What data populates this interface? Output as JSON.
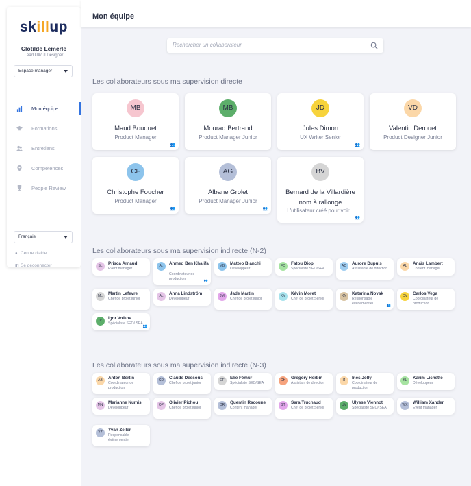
{
  "logo": {
    "prefix": "sk",
    "mid": "ill",
    "suffix": "up"
  },
  "user": {
    "name": "Clotilde Lemerle",
    "role": "Lead UX/UI Designer"
  },
  "space_select": {
    "value": "Espace manager"
  },
  "nav": [
    {
      "label": "Mon équipe",
      "icon": "bar-chart-icon",
      "active": true
    },
    {
      "label": "Formations",
      "icon": "graduation-cap-icon",
      "active": false
    },
    {
      "label": "Entretiens",
      "icon": "users-icon",
      "active": false
    },
    {
      "label": "Compétences",
      "icon": "location-pin-icon",
      "active": false
    },
    {
      "label": "People Review",
      "icon": "trophy-icon",
      "active": false
    }
  ],
  "language": {
    "value": "Français"
  },
  "footer": {
    "help": "Centre d'aide",
    "logout": "Se déconnecter"
  },
  "page": {
    "title": "Mon équipe"
  },
  "search": {
    "placeholder": "Rechercher un collaborateur"
  },
  "sections": {
    "direct": "Les collaborateurs sous ma supervision directe",
    "n2": "Les collaborateurs sous ma supervision indirecte (N-2)",
    "n3": "Les collaborateurs sous ma supervision indirecte (N-3)"
  },
  "direct_reports": [
    {
      "initials": "MB",
      "name": "Maud Bouquet",
      "role": "Product Manager",
      "color": "#f6c6cf",
      "team": true
    },
    {
      "initials": "MB",
      "name": "Mourad Bertrand",
      "role": "Product Manager Junior",
      "color": "#5cae6a",
      "team": false
    },
    {
      "initials": "JD",
      "name": "Jules Dimon",
      "role": "UX Writer Senior",
      "color": "#f7d33c",
      "team": true
    },
    {
      "initials": "VD",
      "name": "Valentin Derouet",
      "role": "Product Designer Junior",
      "color": "#fbd7a8",
      "team": false
    },
    {
      "initials": "CF",
      "name": "Christophe Foucher",
      "role": "Product Manager",
      "color": "#8dc4ec",
      "team": true
    },
    {
      "initials": "AG",
      "name": "Albane Grolet",
      "role": "Product Manager Junior",
      "color": "#b4bfd8",
      "team": true
    },
    {
      "initials": "BV",
      "name": "Bernard de la Villardière nom à rallonge",
      "role": "L'utilisateur créé pour voir...",
      "color": "#d5d5d5",
      "team": true
    }
  ],
  "n2_reports": [
    {
      "initials": "SL",
      "name": "Prisca Arnaud",
      "role": "Event manager",
      "color": "#e4c4e6",
      "team": false
    },
    {
      "initials": "A..",
      "name": "Ahmed Ben Khalifa",
      "role": "Coordinateur de production",
      "color": "#8dc4ec",
      "team": true
    },
    {
      "initials": "MB",
      "name": "Matteo Bianchi",
      "role": "Développeur",
      "color": "#8dc4ec",
      "team": false
    },
    {
      "initials": "FD",
      "name": "Fatou Diop",
      "role": "Spécialiste SEO/SEA",
      "color": "#a6e3a1",
      "team": false
    },
    {
      "initials": "AD",
      "name": "Aurore Dupuis",
      "role": "Assistante de direction",
      "color": "#9fcdf0",
      "team": false
    },
    {
      "initials": "AL",
      "name": "Anaïs Lambert",
      "role": "Content manager",
      "color": "#fbd7a8",
      "team": false
    },
    {
      "initials": "ML",
      "name": "Martin Lefevre",
      "role": "Chef de projet junior",
      "color": "#d5d5d5",
      "team": false
    },
    {
      "initials": "AL",
      "name": "Anna Lindström",
      "role": "Développeur",
      "color": "#e4c4e6",
      "team": false
    },
    {
      "initials": "JM",
      "name": "Jade Martin",
      "role": "Chef de projet junior",
      "color": "#e2a6ea",
      "team": false
    },
    {
      "initials": "KM",
      "name": "Kévin Moret",
      "role": "Chef de projet Senior",
      "color": "#a7e2ec",
      "team": false
    },
    {
      "initials": "KN",
      "name": "Katarina Novak",
      "role": "Responsable évènementiel",
      "color": "#d8c3a2",
      "team": true
    },
    {
      "initials": "CV",
      "name": "Carlos Vega",
      "role": "Coordinateur de production",
      "color": "#f7d33c",
      "team": false
    },
    {
      "initials": "IV",
      "name": "Igor Volkov",
      "role": "Spécialiste SEO/ SEA",
      "color": "#5cae6a",
      "team": true
    }
  ],
  "n3_reports": [
    {
      "initials": "AB",
      "name": "Anton Bertin",
      "role": "Coordinateur de production",
      "color": "#fbd7a8",
      "team": false
    },
    {
      "initials": "CD",
      "name": "Claude Dessous",
      "role": "Chef de projet junior",
      "color": "#b4bfd8",
      "team": false
    },
    {
      "initials": "EF",
      "name": "Elie Fémur",
      "role": "Spécialiste SEO/SEA",
      "color": "#d5d5d5",
      "team": false
    },
    {
      "initials": "GH",
      "name": "Gregory Herbin",
      "role": "Assistant de direction",
      "color": "#f6a37d",
      "team": false
    },
    {
      "initials": "IJ",
      "name": "Inès Jolly",
      "role": "Coordinateur de production",
      "color": "#fbd7a8",
      "team": false
    },
    {
      "initials": "KL",
      "name": "Karim Lichette",
      "role": "Développeur",
      "color": "#a6e3a1",
      "team": false
    },
    {
      "initials": "MN",
      "name": "Marianne Numis",
      "role": "Développeur",
      "color": "#e4c4e6",
      "team": false
    },
    {
      "initials": "OP",
      "name": "Olivier Pichou",
      "role": "Chef de projet junior",
      "color": "#e4c4e6",
      "team": false
    },
    {
      "initials": "QR",
      "name": "Quentin Racoune",
      "role": "Content manager",
      "color": "#b4bfd8",
      "team": false
    },
    {
      "initials": "ST",
      "name": "Sara Truchaud",
      "role": "Chef de projet Senior",
      "color": "#e2a6ea",
      "team": false
    },
    {
      "initials": "UV",
      "name": "Ulysse Viennot",
      "role": "Spécialiste SEO/ SEA",
      "color": "#5cae6a",
      "team": false
    },
    {
      "initials": "WX",
      "name": "William Xander",
      "role": "Event manager",
      "color": "#b4bfd8",
      "team": false
    },
    {
      "initials": "YZ",
      "name": "Yvan Zeller",
      "role": "Responsable évènementiel",
      "color": "#b4bfd8",
      "team": false
    }
  ]
}
